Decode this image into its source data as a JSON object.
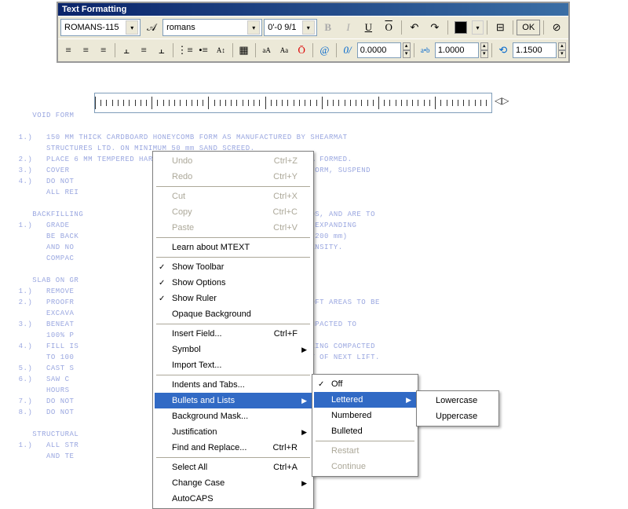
{
  "titlebar": "Text Formatting",
  "toolbar": {
    "style_combo": "ROMANS-115",
    "font_combo": "romans",
    "height_combo": "0'-0 9/1",
    "ok_label": "OK",
    "num1": "0.0000",
    "num2": "1.0000",
    "num3": "1.1500"
  },
  "ruler": {
    "arrows": "◁▷"
  },
  "menu_main": {
    "undo": "Undo",
    "undo_key": "Ctrl+Z",
    "redo": "Redo",
    "redo_key": "Ctrl+Y",
    "cut": "Cut",
    "cut_key": "Ctrl+X",
    "copy": "Copy",
    "copy_key": "Ctrl+C",
    "paste": "Paste",
    "paste_key": "Ctrl+V",
    "learn": "Learn about MTEXT",
    "show_toolbar": "Show Toolbar",
    "show_options": "Show Options",
    "show_ruler": "Show Ruler",
    "opaque": "Opaque Background",
    "insert_field": "Insert Field...",
    "insert_field_key": "Ctrl+F",
    "symbol": "Symbol",
    "import_text": "Import Text...",
    "indents": "Indents and Tabs...",
    "bullets": "Bullets and Lists",
    "bg_mask": "Background Mask...",
    "justification": "Justification",
    "find": "Find and Replace...",
    "find_key": "Ctrl+R",
    "select_all": "Select All",
    "select_all_key": "Ctrl+A",
    "change_case": "Change Case",
    "autocaps": "AutoCAPS"
  },
  "menu_bullets": {
    "off": "Off",
    "lettered": "Lettered",
    "numbered": "Numbered",
    "bulleted": "Bulleted",
    "restart": "Restart",
    "continue": "Continue"
  },
  "menu_lettered": {
    "lowercase": "Lowercase",
    "uppercase": "Uppercase"
  },
  "doctext": "       VOID FORM\n\n    1.)   150 MM THICK CARDBOARD HONEYCOMB FORM AS MANUFACTURED BY SHEARMAT\n          STRUCTURES LTD. ON MINIMUM 50 mm SAND SCREED.\n    2.)   PLACE 6 MM TEMPERED HARDBOARD OVER VOID FORM FOR FULL AREA FORMED.\n    3.)   COVER                                RCING STEEL ON VOID FORM, SUSPEND\n    4.)   DO NOT                               RMWORK.\n          ALL REI\n\n       BACKFILLING                             CARRY CANTILEVER LOADS, AND ARE TO\n    1.)   GRADE                                AND OUT, USING A NON-EXPANDING\n          BE BACK                              TS NOT EXCEEDING 8\" (200 mm)\n          AND NO                               D PROCTOR MAX, DRY DENSITY.\n          COMPAC\n\n       SLAB ON GR\n    1.)   REMOVE                               S MATERIAL.\n    2.)   PROOFR                               NY SOFT AREAS. ANY SOFT AREAS TO BE\n          EXCAVA\n    3.)   BENEAT                               250mm GRAVEL FILL COMPACTED TO\n          100% P                                DENSITY.\n    4.)   FILL IS                              m LIFTS, EACH LIFT BEING COMPACTED\n          TO 100                               SITY BEFORE PLACEMENT OF NEXT LIFT.\n    5.)   CAST S                               E VAPOR BARRIER.\n    6.)   SAW C                                        F 30 mm WITHIN 24\n          HOURS\n    7.)   DO NOT                                                  SLAB.\n    8.)   DO NOT\n\n       STRUCTURAL\n    1.)   ALL STR                              ION, INSPECTION,\n          AND TE                               DARDS:"
}
